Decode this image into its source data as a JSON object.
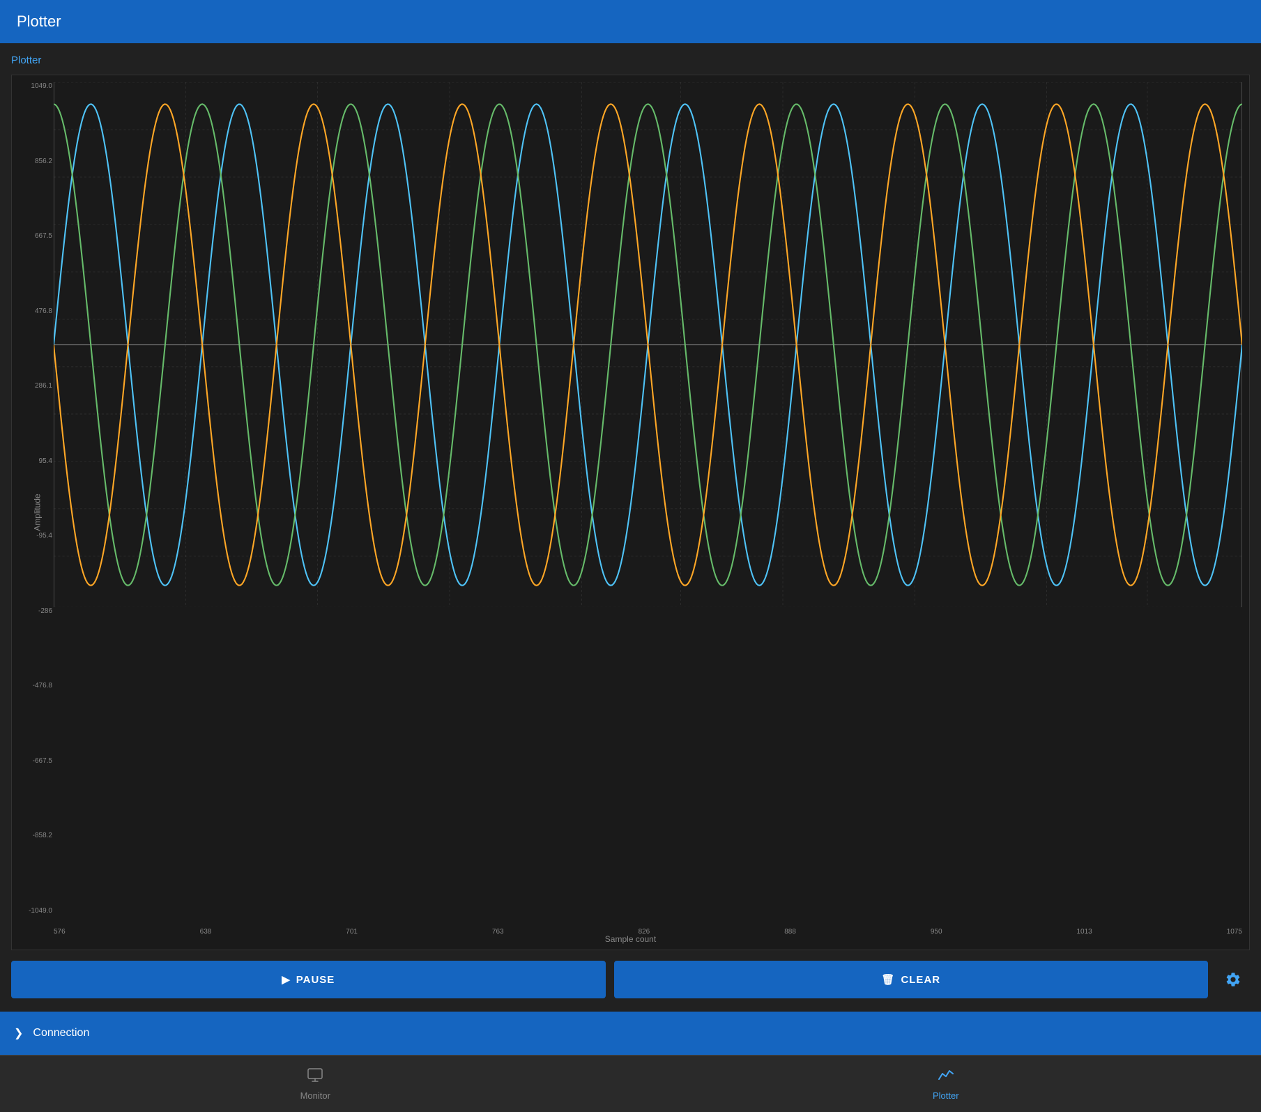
{
  "app": {
    "title": "Plotter"
  },
  "header": {
    "title": "Plotter"
  },
  "section": {
    "label": "Plotter"
  },
  "chart": {
    "y_axis_label": "Amplitude",
    "x_axis_label": "Sample count",
    "y_ticks": [
      "1049.0",
      "856.2",
      "667.5",
      "476.8",
      "286.1",
      "95.4",
      "-95.4",
      "-286",
      "-476.8",
      "-667.5",
      "-858.2",
      "-1049.0"
    ],
    "x_ticks": [
      "576",
      "638",
      "701",
      "763",
      "826",
      "888",
      "950",
      "1013",
      "1075"
    ],
    "colors": {
      "wave1": "#4FC3F7",
      "wave2": "#66BB6A",
      "wave3": "#FFA726"
    }
  },
  "controls": {
    "pause_label": "PAUSE",
    "clear_label": "CLEAR",
    "pause_icon": "▶",
    "clear_icon": "🗑"
  },
  "connection": {
    "label": "Connection",
    "chevron": "❯"
  },
  "bottom_nav": {
    "items": [
      {
        "label": "Monitor",
        "icon": "monitor",
        "active": false
      },
      {
        "label": "Plotter",
        "icon": "chart",
        "active": true
      }
    ]
  }
}
